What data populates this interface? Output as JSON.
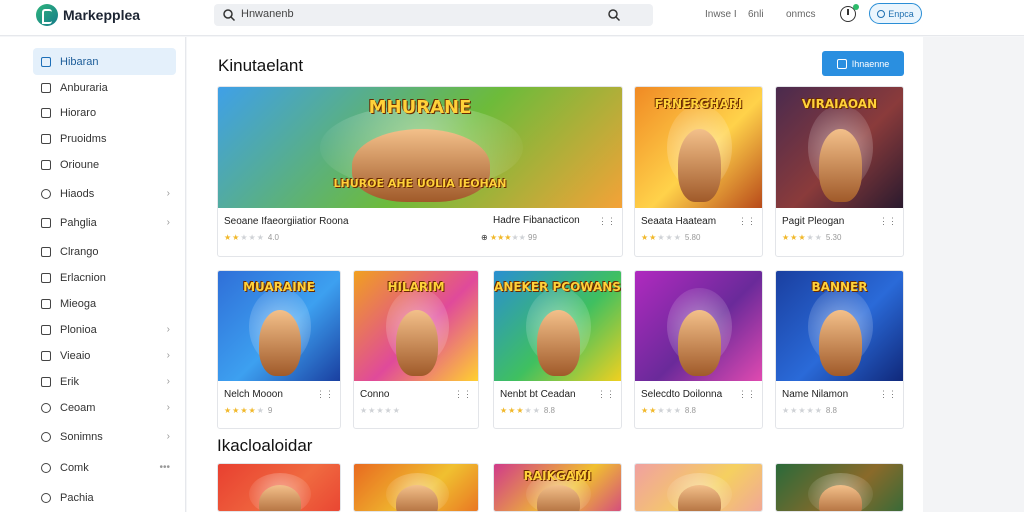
{
  "app": {
    "title": "Markepplea"
  },
  "search": {
    "value": "Hnwanenb"
  },
  "header": {
    "links": [
      "Inwse I",
      "6nli",
      "onmcs"
    ],
    "button_label": "Enpca"
  },
  "sidebar": {
    "items": [
      {
        "label": "Hibaran",
        "icon": "bolt-icon",
        "active": true,
        "chevron": false
      },
      {
        "label": "Anburaria",
        "icon": "square-icon",
        "chevron": false
      },
      {
        "label": "Hioraro",
        "icon": "square-icon",
        "chevron": false
      },
      {
        "label": "Pruoidms",
        "icon": "doc-icon",
        "chevron": false
      },
      {
        "label": "Orioune",
        "icon": "square-icon",
        "chevron": false
      },
      {
        "label": "Hiaods",
        "icon": "circle-icon",
        "chevron": true
      },
      {
        "label": "Pahglia",
        "icon": "edit-icon",
        "chevron": true
      },
      {
        "label": "Clrango",
        "icon": "square-icon",
        "chevron": false
      },
      {
        "label": "Erlacnion",
        "icon": "doc-icon",
        "chevron": false
      },
      {
        "label": "Mieoga",
        "icon": "bookmark-icon",
        "chevron": false
      },
      {
        "label": "Plonioa",
        "icon": "image-icon",
        "chevron": true
      },
      {
        "label": "Vieaio",
        "icon": "play-icon",
        "chevron": true
      },
      {
        "label": "Erik",
        "icon": "doc-icon",
        "chevron": true
      },
      {
        "label": "Ceoam",
        "icon": "settings-icon",
        "chevron": true
      },
      {
        "label": "Sonimns",
        "icon": "circle-icon",
        "chevron": true
      },
      {
        "label": "Comk",
        "icon": "circle-icon",
        "chevron": false,
        "more": true
      },
      {
        "label": "Pachia",
        "icon": "circle-icon",
        "chevron": false
      }
    ]
  },
  "main": {
    "section1_title": "Kinutaelant",
    "action_label": "Ihnaenne",
    "section2_title": "Ikacloaloidar",
    "row1": [
      {
        "name": "Seoane Ifaeorgiiatior Roona",
        "rating": "4.0",
        "stars": 2,
        "banner": "MHURANE",
        "sub": "LHUROE AHE UOLIA IEOHAN",
        "colors": [
          "#3fa0e8",
          "#6dbb3a",
          "#f4a238"
        ]
      },
      {
        "name": "Hadre Fibanacticon",
        "rating": "99",
        "stars": 3,
        "banner": "",
        "sub": "",
        "colors": []
      },
      {
        "name": "Seaata Haateam",
        "rating": "5.80",
        "stars": 2,
        "banner": "FRNERGHARI",
        "sub": "",
        "colors": [
          "#f08a24",
          "#ffd24a",
          "#b84a1a"
        ]
      },
      {
        "name": "Pagit Pleogan",
        "rating": "5.30",
        "stars": 3,
        "banner": "VIRAIAOAN",
        "sub": "",
        "colors": [
          "#4a2a4e",
          "#8a3b3b",
          "#2a1a2e"
        ]
      }
    ],
    "row2": [
      {
        "name": "Nelch Mooon",
        "rating": "9",
        "stars": 4,
        "banner": "MUARAINE",
        "sub": "",
        "colors": [
          "#2f6fd8",
          "#3da0f0",
          "#1a3fa0"
        ]
      },
      {
        "name": "Conno",
        "rating": "",
        "stars": 0,
        "banner": "HILARIM",
        "sub": "",
        "colors": [
          "#f0a020",
          "#e04a9a",
          "#ffd030"
        ]
      },
      {
        "name": "Nenbt bt Ceadan",
        "rating": "8.8",
        "stars": 3,
        "banner": "ANEKER PCOWANS",
        "sub": "",
        "colors": [
          "#2a8fd0",
          "#3fc060",
          "#f0d020"
        ]
      },
      {
        "name": "Selecdto Doilonna",
        "rating": "8.8",
        "stars": 2,
        "banner": "",
        "sub": "",
        "colors": [
          "#b02abf",
          "#6a2a9a",
          "#e04ab0"
        ]
      },
      {
        "name": "Name Nilamon",
        "rating": "8.8",
        "stars": 0,
        "banner": "BANNER",
        "sub": "",
        "colors": [
          "#1a3fa0",
          "#2a6ad8",
          "#10287a"
        ]
      }
    ],
    "row3_colors": [
      [
        "#e84030",
        "#f06a40"
      ],
      [
        "#e86a20",
        "#f0c030"
      ],
      [
        "#d03a8a",
        "#f0c030"
      ],
      [
        "#f0a0a0",
        "#f5d060"
      ],
      [
        "#2a6a3a",
        "#8a6a2a"
      ]
    ],
    "row3_banner": "RAIKGAMI"
  }
}
